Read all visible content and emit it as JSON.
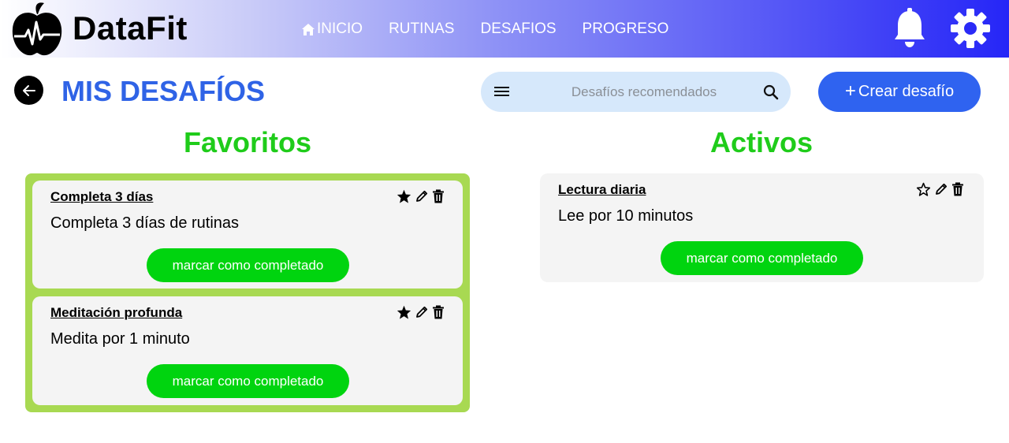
{
  "brand": "DataFit",
  "nav": [
    {
      "label": "INICIO"
    },
    {
      "label": "RUTINAS"
    },
    {
      "label": "DESAFIOS"
    },
    {
      "label": "PROGRESO"
    }
  ],
  "page_title": "MIS DESAFÍOS",
  "search": {
    "placeholder": "Desafíos recomendados"
  },
  "create_button": {
    "plus": "+",
    "label": "Crear desafío"
  },
  "favorites": {
    "title": "Favoritos",
    "cards": [
      {
        "title": "Completa 3 días",
        "description": "Completa 3 días de rutinas",
        "button": "marcar como completado",
        "starred": true
      },
      {
        "title": "Meditación profunda",
        "description": "Medita por 1 minuto",
        "button": "marcar como completado",
        "starred": true
      }
    ]
  },
  "active": {
    "title": "Activos",
    "cards": [
      {
        "title": "Lectura diaria",
        "description": "Lee por 10 minutos",
        "button": "marcar como completado",
        "starred": false
      }
    ]
  },
  "colors": {
    "accent_blue": "#2f63e6",
    "success_green": "#00d40f",
    "section_green": "#1fcc1a",
    "favorites_border": "#a8d952",
    "search_bg": "#d6e8fb"
  }
}
